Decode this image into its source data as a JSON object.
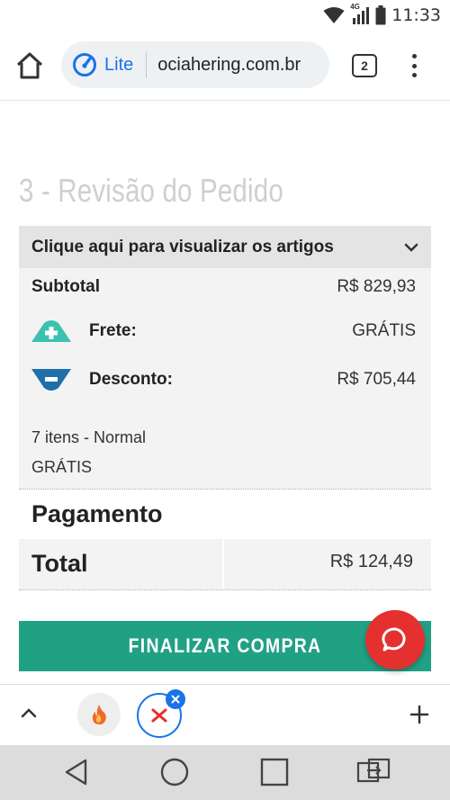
{
  "status_bar": {
    "time": "11:33",
    "network": "4G",
    "icons": [
      "wifi-icon",
      "signal-icon",
      "battery-icon"
    ]
  },
  "browser": {
    "lite_label": "Lite",
    "url": "ociahering.com.br",
    "tab_count": "2",
    "accent": "#1a73e8"
  },
  "page": {
    "section_title": "3 - Revisão do Pedido",
    "accordion_label": "Clique aqui para visualizar os artigos",
    "subtotal_label": "Subtotal",
    "subtotal_value": "R$ 829,93",
    "shipping_label": "Frete:",
    "shipping_value": "GRÁTIS",
    "discount_label": "Desconto:",
    "discount_value": "R$ 705,44",
    "shipping_method": "7 itens - Normal",
    "shipping_method_price": "GRÁTIS",
    "payment_title": "Pagamento",
    "total_label": "Total",
    "total_value": "R$ 124,49",
    "checkout_label": "FINALIZAR COMPRA",
    "colors": {
      "checkout": "#21a184",
      "shipping_icon": "#3cc1b0",
      "discount_icon": "#1f6faa",
      "chat": "#e53030"
    }
  }
}
